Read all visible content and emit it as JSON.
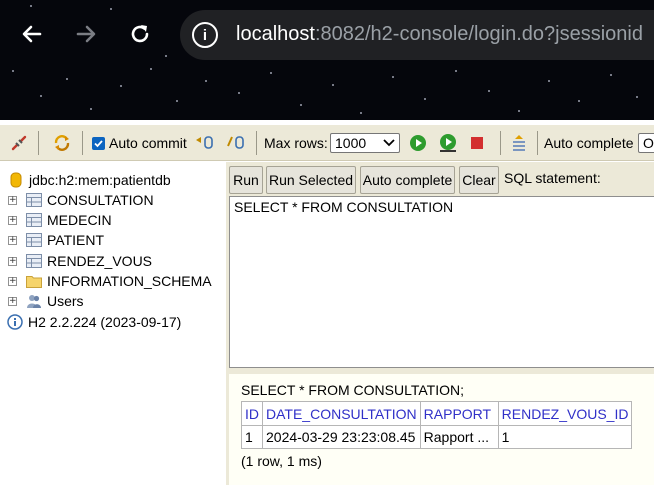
{
  "browser": {
    "url_host": "localhost",
    "url_rest": ":8082/h2-console/login.do?jsessionid"
  },
  "toolbar": {
    "auto_commit_label": "Auto commit",
    "max_rows_label": "Max rows:",
    "max_rows_value": "1000",
    "auto_complete_label": "Auto complete",
    "auto_complete_value": "O"
  },
  "tree": {
    "connection": "jdbc:h2:mem:patientdb",
    "tables": [
      "CONSULTATION",
      "MEDECIN",
      "PATIENT",
      "RENDEZ_VOUS"
    ],
    "schema": "INFORMATION_SCHEMA",
    "users": "Users",
    "version": "H2 2.2.224 (2023-09-17)"
  },
  "buttons": {
    "run": "Run",
    "run_selected": "Run Selected",
    "auto_complete": "Auto complete",
    "clear": "Clear",
    "sql_label": "SQL statement:"
  },
  "sql": {
    "query": "SELECT * FROM CONSULTATION"
  },
  "result": {
    "statement": "SELECT * FROM CONSULTATION;",
    "columns": [
      "ID",
      "DATE_CONSULTATION",
      "RAPPORT",
      "RENDEZ_VOUS_ID"
    ],
    "rows": [
      [
        "1",
        "2024-03-29 23:23:08.45",
        "Rapport ...",
        "1"
      ]
    ],
    "row_count": "(1 row, 1 ms)"
  },
  "colors": {
    "panel_bg": "#ece9d8",
    "header_link": "#3030c8",
    "browser_bg": "#05060c"
  }
}
